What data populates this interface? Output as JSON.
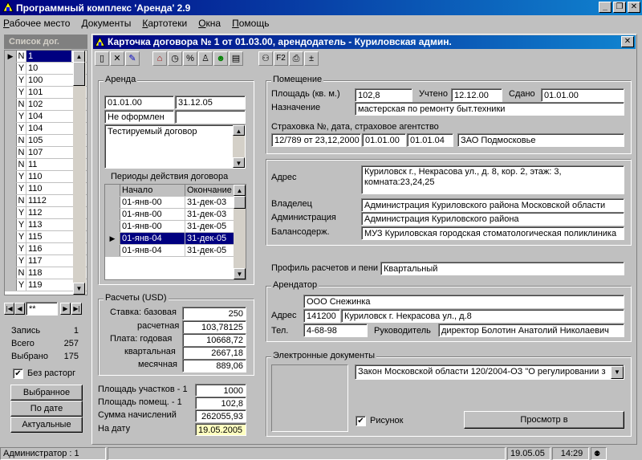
{
  "app": {
    "title": "Программный комплекс 'Аренда' 2.9"
  },
  "menu": [
    "Рабочее место",
    "Документы",
    "Картотеки",
    "Окна",
    "Помощь"
  ],
  "left_panel": {
    "header": "Список дог.",
    "rows": [
      {
        "flag": "N",
        "num": "1",
        "selected": true
      },
      {
        "flag": "Y",
        "num": "10"
      },
      {
        "flag": "Y",
        "num": "100"
      },
      {
        "flag": "Y",
        "num": "101"
      },
      {
        "flag": "N",
        "num": "102"
      },
      {
        "flag": "Y",
        "num": "104"
      },
      {
        "flag": "Y",
        "num": "104"
      },
      {
        "flag": "N",
        "num": "105"
      },
      {
        "flag": "N",
        "num": "107"
      },
      {
        "flag": "N",
        "num": "11"
      },
      {
        "flag": "Y",
        "num": "110"
      },
      {
        "flag": "Y",
        "num": "110"
      },
      {
        "flag": "N",
        "num": "1112"
      },
      {
        "flag": "Y",
        "num": "112"
      },
      {
        "flag": "Y",
        "num": "113"
      },
      {
        "flag": "Y",
        "num": "115"
      },
      {
        "flag": "Y",
        "num": "116"
      },
      {
        "flag": "Y",
        "num": "117"
      },
      {
        "flag": "N",
        "num": "118"
      },
      {
        "flag": "Y",
        "num": "119"
      }
    ],
    "nav_value": "**",
    "stats": [
      {
        "label": "Запись",
        "value": "1"
      },
      {
        "label": "Всего",
        "value": "257"
      },
      {
        "label": "Выбрано",
        "value": "175"
      }
    ],
    "checkbox_label": "Без расторг",
    "buttons": [
      "Выбранное",
      "По дате",
      "Актуальные"
    ]
  },
  "card": {
    "title": "Карточка договора № 1 от 01.03.00, арендодатель - Куриловская админ.",
    "arenda": {
      "title": "Аренда",
      "date_from": "01.01.00",
      "date_to": "31.12.05",
      "status": "Не оформлен",
      "status2": "",
      "comment": "Тестируемый договор",
      "periods_title": "Периоды действия договора",
      "periods_headers": [
        "Начало",
        "Окончание"
      ],
      "periods": [
        {
          "start": "01-янв-00",
          "end": "31-дек-03"
        },
        {
          "start": "01-янв-00",
          "end": "31-дек-03"
        },
        {
          "start": "01-янв-00",
          "end": "31-дек-05"
        },
        {
          "start": "01-янв-04",
          "end": "31-дек-05",
          "selected": true
        },
        {
          "start": "01-янв-04",
          "end": "31-дек-05"
        }
      ]
    },
    "raschety": {
      "title": "Расчеты (USD)",
      "rows": [
        {
          "label": "Ставка: базовая",
          "value": "250"
        },
        {
          "label": "расчетная",
          "value": "103,78125"
        },
        {
          "label": "Плата:  годовая",
          "value": "10668,72"
        },
        {
          "label": "квартальная",
          "value": "2667,18"
        },
        {
          "label": "месячная",
          "value": "889,06"
        }
      ]
    },
    "summary": [
      {
        "label": "Площадь участков - 1",
        "value": "1000"
      },
      {
        "label": "Площадь помещ. - 1",
        "value": "102,8"
      },
      {
        "label": "Сумма начислений",
        "value": "262055,93"
      },
      {
        "label": "На дату",
        "value": "19.05.2005"
      }
    ],
    "pomeshchenie": {
      "title": "Помещение",
      "area_label": "Площадь (кв. м.)",
      "area": "102,8",
      "uchteno_label": "Учтено",
      "uchteno": "12.12.00",
      "sdano_label": "Сдано",
      "sdano": "01.01.00",
      "naznach_label": "Назначение",
      "naznach": "мастерская по ремонту быт.техники",
      "strah_label": "Страховка №, дата, страховое агентство",
      "strah_num": "12/789 от 23,12,2000",
      "strah_from": "01.01.00",
      "strah_to": "01.01.04",
      "strah_agent": "ЗАО Подмосковье"
    },
    "adres": {
      "adres_label": "Адрес",
      "adres": "Куриловск г., Некрасова ул., д. 8, кор. 2, этаж: 3, комната:23,24,25",
      "vladelets_label": "Владелец",
      "vladelets": "Администрация Куриловского района Московской области",
      "admin_label": "Администрация",
      "admin": "Администрация Куриловского района",
      "balans_label": "Балансодерж.",
      "balans": "МУЗ Куриловская городская стоматологическая поликлиника"
    },
    "profil": {
      "label": "Профиль расчетов и пени",
      "value": "Квартальный"
    },
    "arendator": {
      "title": "Арендатор",
      "name": "ООО Снежинка",
      "adres_label": "Адрес",
      "index": "141200",
      "adres": "Куриловск г. Некрасова ул., д.8",
      "tel_label": "Тел.",
      "tel": "4-68-98",
      "ruk_label": "Руководитель",
      "ruk": "директор Болотин Анатолий Николаевич"
    },
    "edocs": {
      "title": "Электронные документы",
      "selected": "Закон Московской области 120/2004-ОЗ \"О регулировании з",
      "checkbox_label": "Рисунок",
      "button": "Просмотр в"
    }
  },
  "status": {
    "user": "Администратор : 1",
    "date": "19.05.05",
    "time": "14:29"
  }
}
